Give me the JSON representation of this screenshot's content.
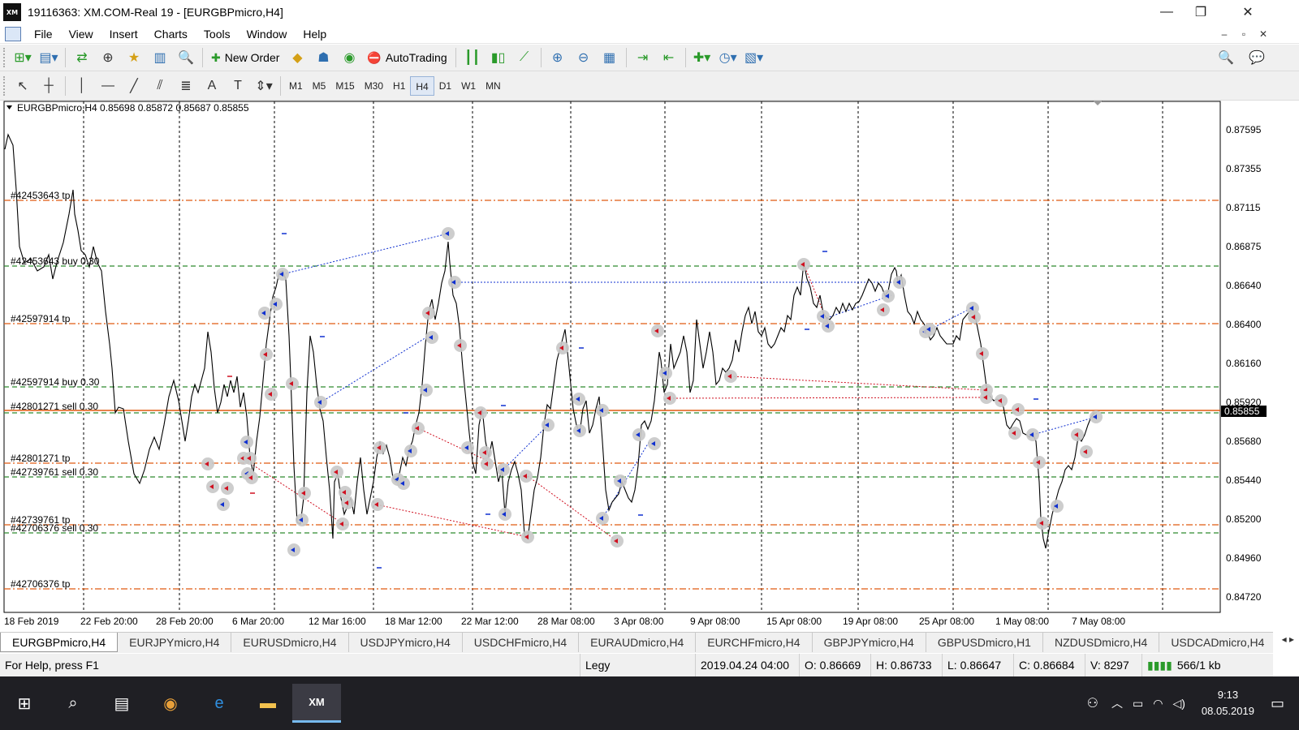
{
  "window": {
    "title": "19116363: XM.COM-Real 19 - [EURGBPmicro,H4]",
    "app_logo": "XM",
    "controls": [
      "—",
      "❐",
      "✕"
    ]
  },
  "menu": [
    "File",
    "View",
    "Insert",
    "Charts",
    "Tools",
    "Window",
    "Help"
  ],
  "toolbar": {
    "new_order_label": "New Order",
    "autotrading_label": "AutoTrading",
    "timeframes": [
      "M1",
      "M5",
      "M15",
      "M30",
      "H1",
      "H4",
      "D1",
      "W1",
      "MN"
    ],
    "active_timeframe": "H4"
  },
  "chart": {
    "header": "EURGBPmicro,H4  0.85698 0.85872 0.85687 0.85855",
    "current_price": "0.85855",
    "price_labels": [
      "0.87595",
      "0.87355",
      "0.87115",
      "0.86875",
      "0.86640",
      "0.86400",
      "0.86160",
      "0.85920",
      "0.85680",
      "0.85440",
      "0.85200",
      "0.84960",
      "0.84720"
    ],
    "time_labels": [
      "18 Feb 2019",
      "22 Feb 20:00",
      "28 Feb 20:00",
      "6 Mar 20:00",
      "12 Mar 16:00",
      "18 Mar 12:00",
      "22 Mar 12:00",
      "28 Mar 08:00",
      "3 Apr 08:00",
      "9 Apr 08:00",
      "15 Apr 08:00",
      "19 Apr 08:00",
      "25 Apr 08:00",
      "1 May 08:00",
      "7 May 08:00"
    ],
    "order_lines": [
      {
        "label": "#42453643 tp",
        "type": "tp"
      },
      {
        "label": "#42453643 buy 0.30",
        "type": "entry"
      },
      {
        "label": "#42597914 tp",
        "type": "tp"
      },
      {
        "label": "#42597914 buy 0.30",
        "type": "entry"
      },
      {
        "label": "#42801271 sell 0.30",
        "type": "entry"
      },
      {
        "label": "#42801271 tp",
        "type": "tp"
      },
      {
        "label": "#42739761 sell 0.30",
        "type": "entry"
      },
      {
        "label": "#42739761 tp",
        "type": "tp"
      },
      {
        "label": "#42706376 sell 0.30",
        "type": "entry"
      },
      {
        "label": "#42706376 tp",
        "type": "tp"
      }
    ],
    "colors": {
      "tp_line": "#e05a10",
      "entry_line": "#2e8b2e",
      "price_line": "#e05a10",
      "buy_arrow": "#1030d0",
      "sell_arrow": "#d01020",
      "marker": "#c8c8c8",
      "price_series": "#000000"
    }
  },
  "tabs": [
    "EURGBPmicro,H4",
    "EURJPYmicro,H4",
    "EURUSDmicro,H4",
    "USDJPYmicro,H4",
    "USDCHFmicro,H4",
    "EURAUDmicro,H4",
    "EURCHFmicro,H4",
    "GBPJPYmicro,H4",
    "GBPUSDmicro,H1",
    "NZDUSDmicro,H4",
    "USDCADmicro,H4"
  ],
  "status": {
    "help": "For Help, press F1",
    "profile": "Legy",
    "datetime": "2019.04.24 04:00",
    "open": "O: 0.86669",
    "high": "H: 0.86733",
    "low": "L: 0.86647",
    "close": "C: 0.86684",
    "volume": "V: 8297",
    "traffic": "566/1 kb"
  },
  "taskbar": {
    "time": "9:13",
    "date": "08.05.2019",
    "xm_label": "XM"
  }
}
